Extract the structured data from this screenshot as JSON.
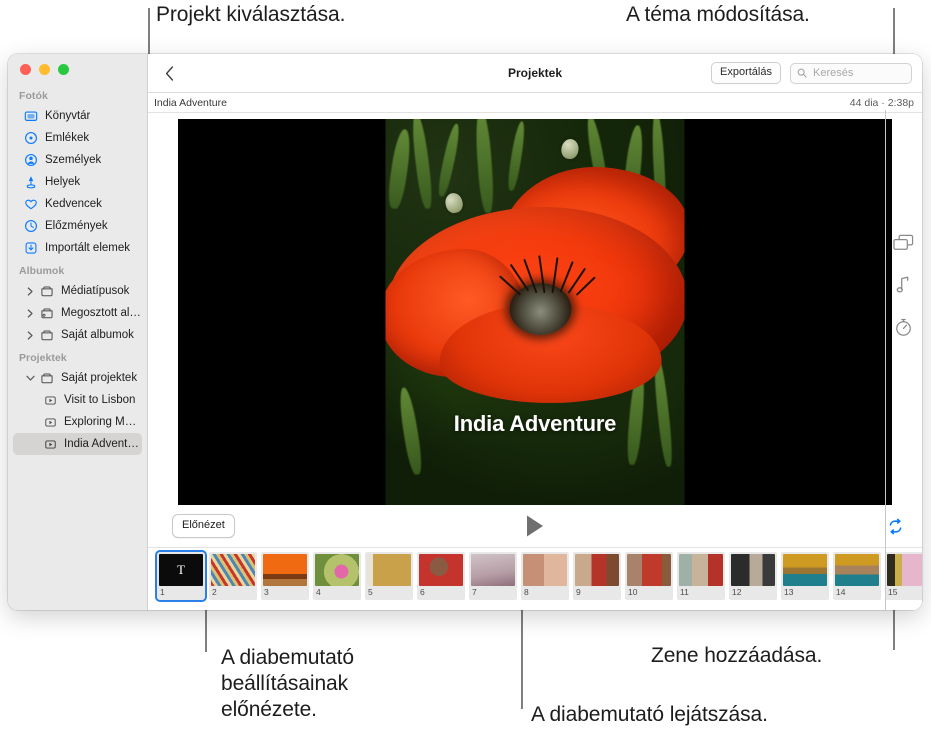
{
  "callouts": [
    {
      "id": "select-project",
      "text": "Projekt kiválasztása."
    },
    {
      "id": "change-theme",
      "text": "A téma módosítása."
    },
    {
      "id": "preview-settings",
      "text": "A diabemutató\nbeállításainak\nelőnézete."
    },
    {
      "id": "play-slideshow",
      "text": "A diabemutató lejátszása."
    },
    {
      "id": "add-music",
      "text": "Zene hozzáadása."
    }
  ],
  "window": {
    "traffic_lights": [
      "close",
      "minimize",
      "zoom"
    ]
  },
  "sidebar": {
    "sections": [
      {
        "title": "Fotók",
        "items": [
          {
            "label": "Könyvtár",
            "icon": "library-icon",
            "selected": false
          },
          {
            "label": "Emlékek",
            "icon": "memories-icon",
            "selected": false
          },
          {
            "label": "Személyek",
            "icon": "people-icon",
            "selected": false
          },
          {
            "label": "Helyek",
            "icon": "places-icon",
            "selected": false
          },
          {
            "label": "Kedvencek",
            "icon": "heart-icon",
            "selected": false
          },
          {
            "label": "Előzmények",
            "icon": "clock-icon",
            "selected": false
          },
          {
            "label": "Importált elemek",
            "icon": "import-icon",
            "selected": false
          }
        ]
      },
      {
        "title": "Albumok",
        "items": [
          {
            "label": "Médiatípusok",
            "icon": "folder-icon",
            "disclosure": "collapsed",
            "selected": false
          },
          {
            "label": "Megosztott albumok",
            "icon": "shared-folder-icon",
            "disclosure": "collapsed",
            "selected": false
          },
          {
            "label": "Saját albumok",
            "icon": "folder-icon",
            "disclosure": "collapsed",
            "selected": false
          }
        ]
      },
      {
        "title": "Projektek",
        "items": [
          {
            "label": "Saját projektek",
            "icon": "folder-icon",
            "disclosure": "expanded",
            "selected": false
          },
          {
            "label": "Visit to Lisbon",
            "icon": "slideshow-icon",
            "indent": true,
            "selected": false
          },
          {
            "label": "Exploring Mor...",
            "icon": "slideshow-icon",
            "indent": true,
            "selected": false
          },
          {
            "label": "India Adventure",
            "icon": "slideshow-icon",
            "indent": true,
            "selected": true
          }
        ]
      }
    ]
  },
  "toolbar": {
    "back_icon": "chevron-left-icon",
    "title": "Projektek",
    "export_label": "Exportálás",
    "search_placeholder": "Keresés",
    "search_value": ""
  },
  "subbar": {
    "project_name": "India Adventure",
    "meta": "44 dia · 2:38p"
  },
  "slide": {
    "title_overlay": "India Adventure",
    "photo_alt": "red-poppy-photo"
  },
  "transport": {
    "preview_label": "Előnézet",
    "play_icon": "play-icon",
    "loop_icon": "loop-icon",
    "loop_color": "#0a7bff"
  },
  "filmstrip": {
    "add_label": "+",
    "thumbs": [
      {
        "num": "1",
        "kind": "title",
        "letter": "T",
        "selected": true
      },
      {
        "num": "2",
        "kind": "photo",
        "selected": false
      },
      {
        "num": "3",
        "kind": "photo",
        "selected": false
      },
      {
        "num": "4",
        "kind": "photo",
        "selected": false
      },
      {
        "num": "5",
        "kind": "photo",
        "selected": false
      },
      {
        "num": "6",
        "kind": "photo",
        "selected": false
      },
      {
        "num": "7",
        "kind": "photo",
        "selected": false
      },
      {
        "num": "8",
        "kind": "photo",
        "selected": false
      },
      {
        "num": "9",
        "kind": "photo",
        "selected": false
      },
      {
        "num": "10",
        "kind": "photo",
        "selected": false
      },
      {
        "num": "11",
        "kind": "photo",
        "selected": false
      },
      {
        "num": "12",
        "kind": "photo",
        "selected": false
      },
      {
        "num": "13",
        "kind": "photo",
        "selected": false
      },
      {
        "num": "14",
        "kind": "photo",
        "selected": false
      },
      {
        "num": "15",
        "kind": "photo",
        "selected": false
      }
    ]
  },
  "rail": {
    "items": [
      {
        "icon": "theme-icon",
        "name": "theme-button"
      },
      {
        "icon": "music-note-icon",
        "name": "music-button"
      },
      {
        "icon": "timer-icon",
        "name": "duration-button"
      }
    ]
  }
}
